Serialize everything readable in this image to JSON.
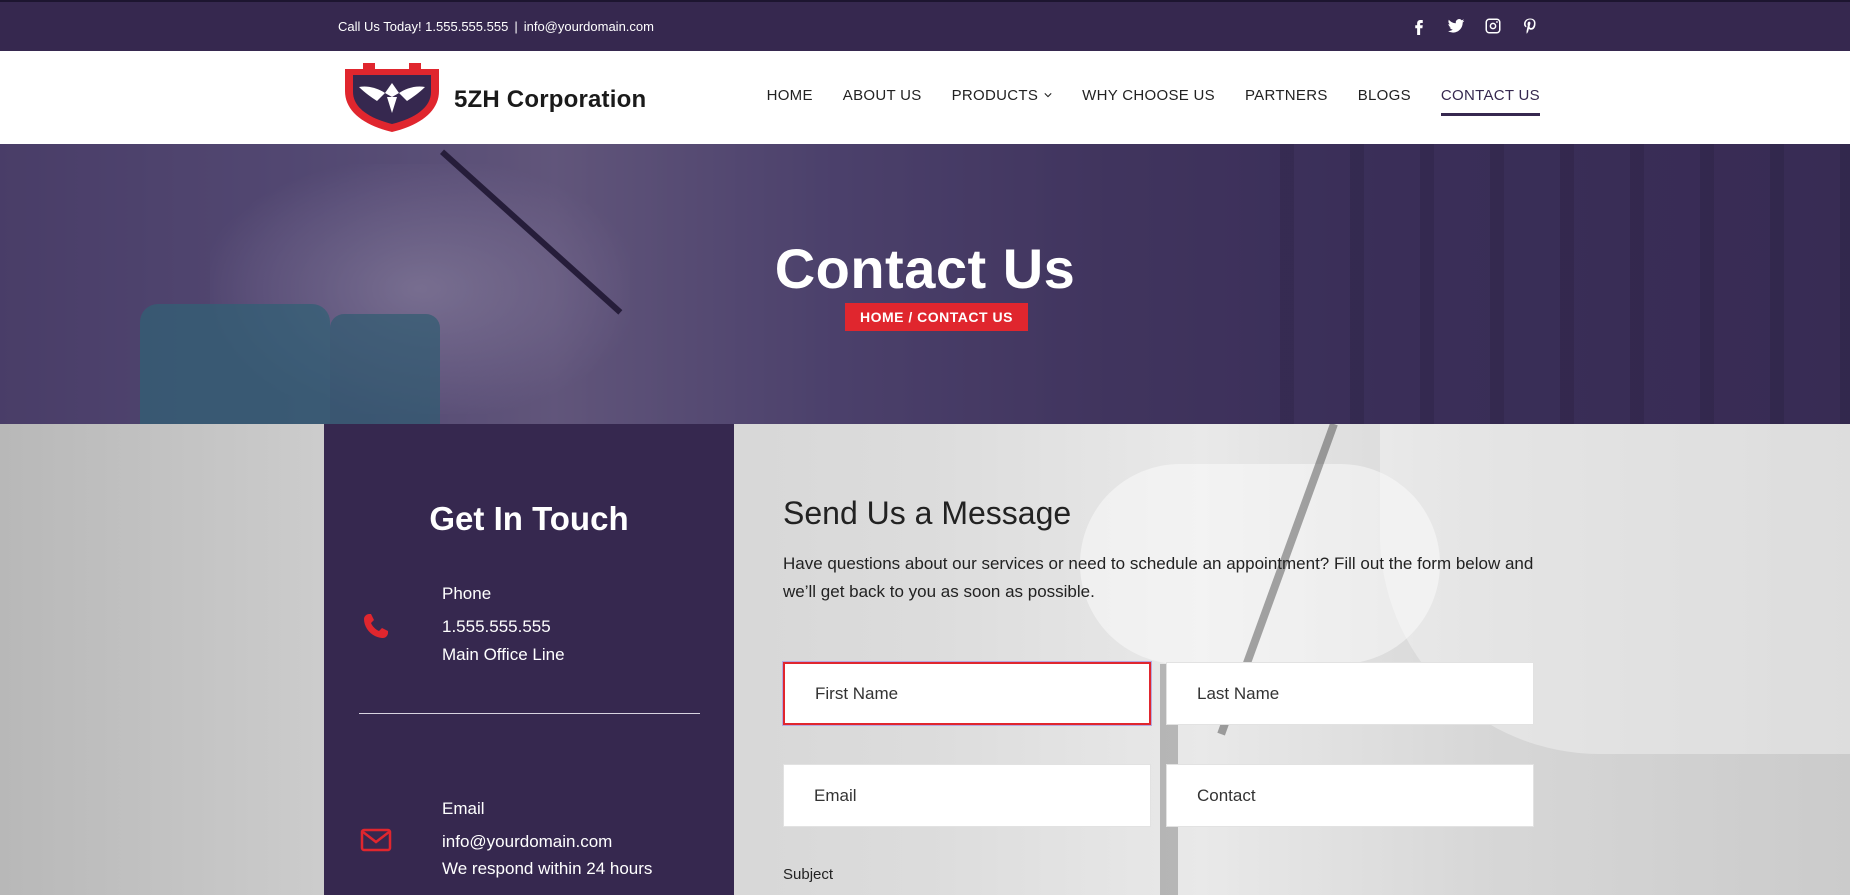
{
  "topbar": {
    "call_text": "Call Us Today! 1.555.555.555",
    "separator": "|",
    "email": "info@yourdomain.com",
    "socials": [
      "facebook-icon",
      "twitter-icon",
      "instagram-icon",
      "pinterest-icon"
    ]
  },
  "header": {
    "brand": "5ZH Corporation",
    "nav": [
      "HOME",
      "ABOUT US",
      "PRODUCTS",
      "WHY CHOOSE US",
      "PARTNERS",
      "BLOGS",
      "CONTACT US"
    ],
    "active_nav": "CONTACT US"
  },
  "hero": {
    "title": "Contact Us",
    "breadcrumb_home": "HOME",
    "breadcrumb_sep": " / ",
    "breadcrumb_current": "CONTACT US"
  },
  "touch": {
    "title": "Get In Touch",
    "phone": {
      "label": "Phone",
      "value": "1.555.555.555",
      "note": "Main Office Line"
    },
    "email": {
      "label": "Email",
      "value": "info@yourdomain.com",
      "note": "We respond within 24 hours"
    }
  },
  "form": {
    "title": "Send Us a Message",
    "description": "Have questions about our services or need to schedule an appointment? Fill out the form below and we’ll get back to you as soon as possible.",
    "first_name_placeholder": "First Name",
    "last_name_placeholder": "Last Name",
    "email_placeholder": "Email",
    "contact_placeholder": "Contact",
    "subject_label": "Subject"
  },
  "colors": {
    "primary": "#36284f",
    "accent": "#e0262e"
  }
}
